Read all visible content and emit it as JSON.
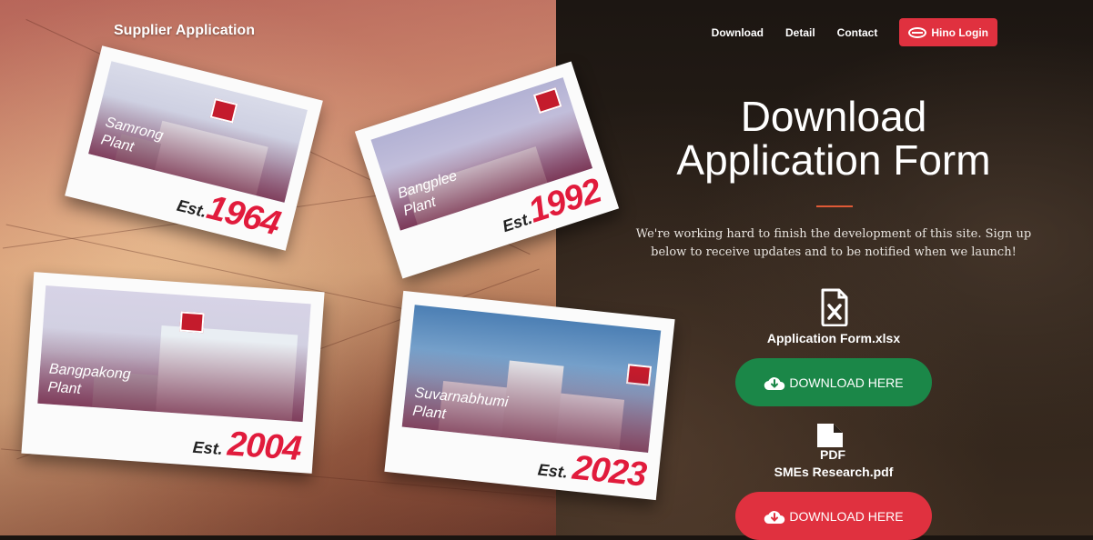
{
  "header": {
    "brand": "Supplier Application",
    "nav": [
      {
        "label": "Download"
      },
      {
        "label": "Detail"
      },
      {
        "label": "Contact"
      }
    ],
    "login_label": "Hino Login"
  },
  "plants": [
    {
      "name": "Samrong\nPlant",
      "est_prefix": "Est.",
      "year": "1964"
    },
    {
      "name": "Bangplee\nPlant",
      "est_prefix": "Est.",
      "year": "1992"
    },
    {
      "name": "Bangpakong\nPlant",
      "est_prefix": "Est.",
      "year": "2004"
    },
    {
      "name": "Suvarnabhumi\nPlant",
      "est_prefix": "Est.",
      "year": "2023"
    }
  ],
  "hero": {
    "title_line1": "Download",
    "title_line2": "Application Form",
    "lead": "We're working hard to finish the development of this site. Sign up below to receive updates and to be notified when we launch!"
  },
  "downloads": [
    {
      "icon": "excel-file-icon",
      "file_name": "Application Form.xlsx",
      "button_label": "DOWNLOAD HERE",
      "color": "#1b8748"
    },
    {
      "icon": "pdf-file-icon",
      "file_name": "SMEs Research.pdf",
      "icon_text": "PDF",
      "button_label": "DOWNLOAD HERE",
      "color": "#e0313f"
    }
  ]
}
